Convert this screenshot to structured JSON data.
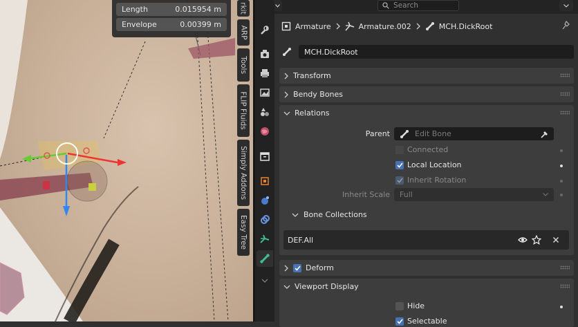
{
  "viewport": {
    "hud": {
      "length_label": "Length",
      "length_value": "0.015954 m",
      "envelope_label": "Envelope",
      "envelope_value": "0.00399 m"
    },
    "side_tabs": [
      "rkit",
      "ARP",
      "Tools",
      "FLIP Fluids",
      "Simply Addons",
      "Easy Tree"
    ]
  },
  "header": {
    "search_placeholder": "Search"
  },
  "breadcrumb": {
    "items": [
      "Armature",
      "Armature.002",
      "MCH.DickRoot"
    ]
  },
  "bone_name": "MCH.DickRoot",
  "panels": {
    "transform": "Transform",
    "bendy_bones": "Bendy Bones",
    "relations": "Relations",
    "deform": "Deform",
    "viewport_display": "Viewport Display"
  },
  "relations": {
    "parent_label": "Parent",
    "parent_placeholder": "Edit Bone",
    "connected": {
      "label": "Connected",
      "checked": false
    },
    "local_location": {
      "label": "Local Location",
      "checked": true
    },
    "inherit_rotation": {
      "label": "Inherit Rotation",
      "checked": true
    },
    "inherit_scale_label": "Inherit Scale",
    "inherit_scale_value": "Full",
    "bone_collections_label": "Bone Collections",
    "collection_name": "DEF.All"
  },
  "deform_enabled": true,
  "viewport_display": {
    "hide": {
      "label": "Hide",
      "checked": false
    },
    "selectable": {
      "label": "Selectable",
      "checked": true
    }
  },
  "colors": {
    "accent": "#4772b3",
    "panel_bg": "#3d3d3d",
    "editor_bg": "#303030"
  }
}
